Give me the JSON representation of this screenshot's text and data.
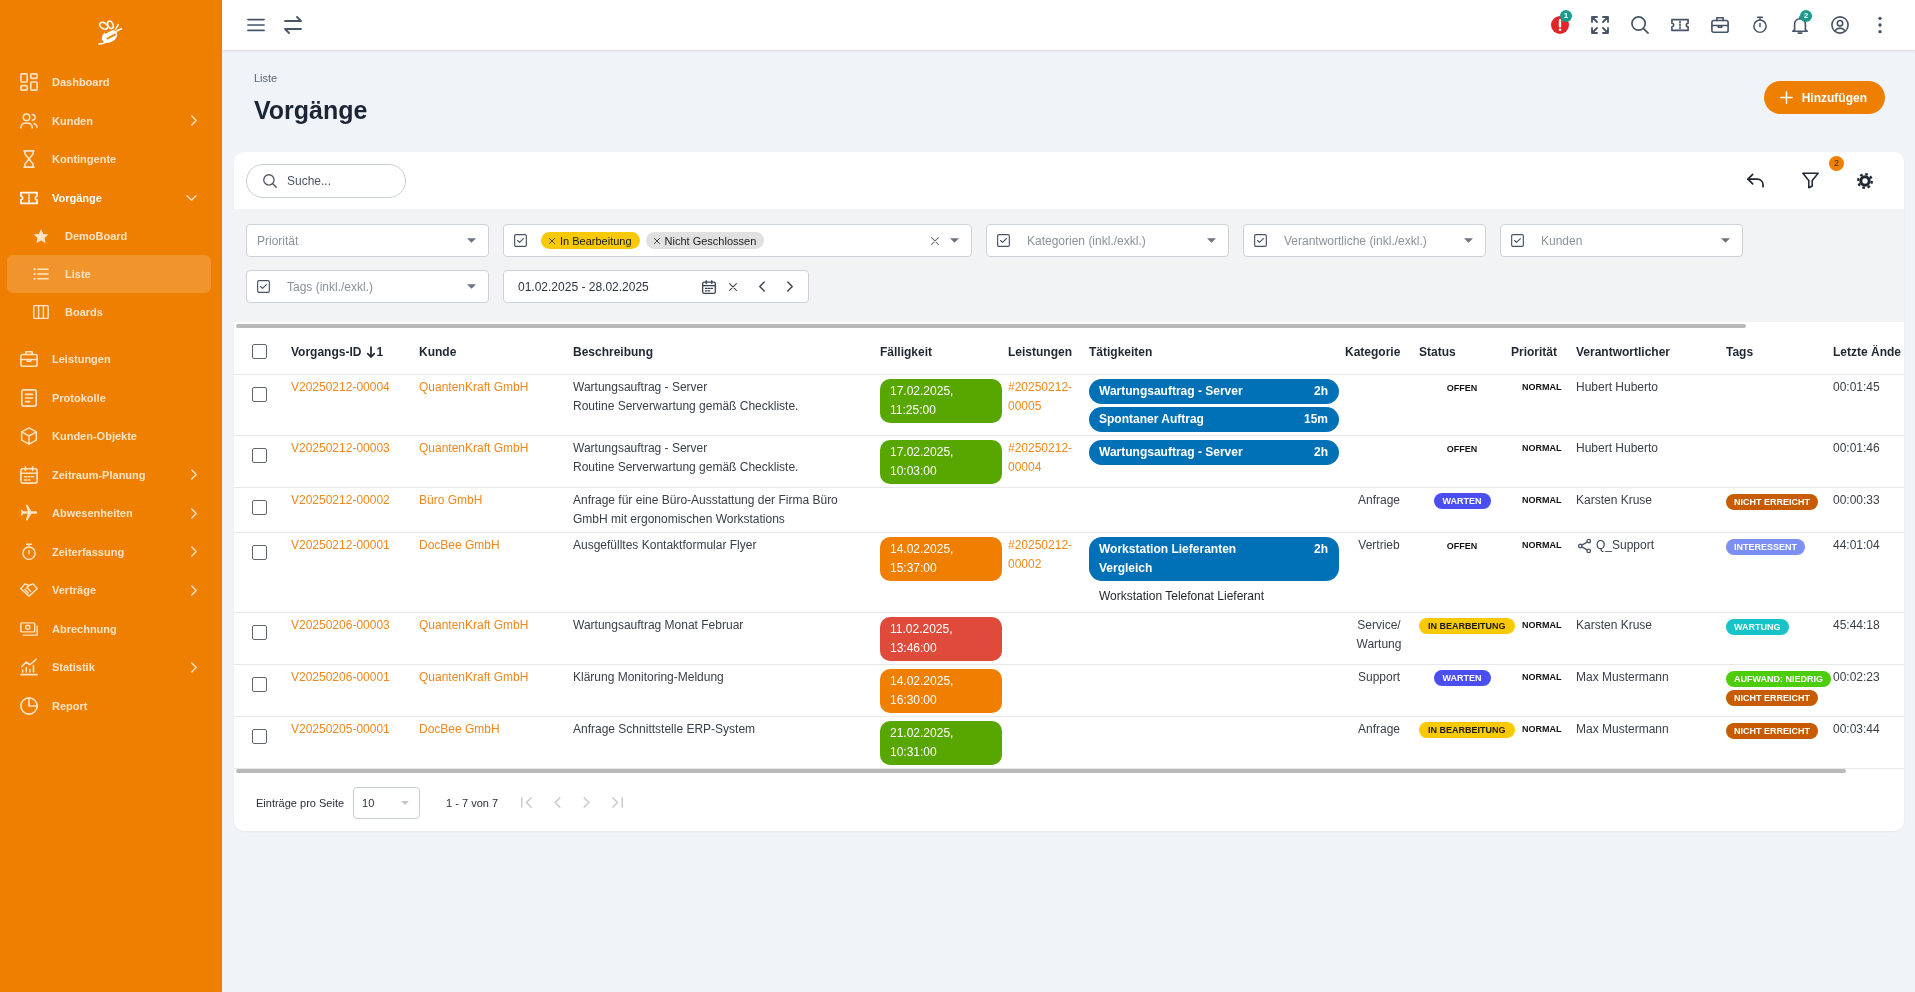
{
  "sidebar": {
    "items": [
      {
        "label": "Dashboard",
        "has_submenu": false,
        "expanded": false,
        "selected": false
      },
      {
        "label": "Kunden",
        "has_submenu": true,
        "expanded": false,
        "selected": false
      },
      {
        "label": "Kontingente",
        "has_submenu": false,
        "expanded": false,
        "selected": false
      },
      {
        "label": "Vorgänge",
        "has_submenu": true,
        "expanded": true,
        "selected": false,
        "children": [
          {
            "label": "DemoBoard",
            "selected": false
          },
          {
            "label": "Liste",
            "selected": true
          },
          {
            "label": "Boards",
            "selected": false
          }
        ]
      },
      {
        "label": "Leistungen",
        "has_submenu": false,
        "expanded": false,
        "selected": false
      },
      {
        "label": "Protokolle",
        "has_submenu": false,
        "expanded": false,
        "selected": false
      },
      {
        "label": "Kunden-Objekte",
        "has_submenu": false,
        "expanded": false,
        "selected": false
      },
      {
        "label": "Zeitraum-Planung",
        "has_submenu": true,
        "expanded": false,
        "selected": false
      },
      {
        "label": "Abwesenheiten",
        "has_submenu": true,
        "expanded": false,
        "selected": false
      },
      {
        "label": "Zeiterfassung",
        "has_submenu": true,
        "expanded": false,
        "selected": false
      },
      {
        "label": "Verträge",
        "has_submenu": true,
        "expanded": false,
        "selected": false
      },
      {
        "label": "Abrechnung",
        "has_submenu": false,
        "expanded": false,
        "selected": false
      },
      {
        "label": "Statistik",
        "has_submenu": true,
        "expanded": false,
        "selected": false
      },
      {
        "label": "Report",
        "has_submenu": false,
        "expanded": false,
        "selected": false
      }
    ]
  },
  "topbar": {
    "alert_badge": "1",
    "notification_badge": "2"
  },
  "header": {
    "breadcrumb": "Liste",
    "title": "Vorgänge",
    "add_button": "Hinzufügen"
  },
  "toolbar": {
    "search": {
      "placeholder": "Suche..."
    },
    "filter_badge": "2"
  },
  "filters": [
    {
      "kind": "select",
      "placeholder": "Priorität"
    },
    {
      "kind": "chips",
      "checked": true,
      "chips": [
        {
          "label": "In Bearbeitung",
          "color": "#f9c900"
        },
        {
          "label": "Nicht Geschlossen",
          "color": "#e1e1e1"
        }
      ]
    },
    {
      "kind": "select",
      "checked": true,
      "placeholder": "Kategorien (inkl./exkl.)"
    },
    {
      "kind": "select",
      "checked": true,
      "placeholder": "Verantwortliche (inkl./exkl.)"
    },
    {
      "kind": "select",
      "checked": true,
      "placeholder": "Kunden"
    },
    {
      "kind": "select",
      "checked": true,
      "placeholder": "Tags (inkl./exkl.)"
    },
    {
      "kind": "daterange",
      "value": "01.02.2025 - 28.02.2025"
    }
  ],
  "table": {
    "all_checked": false,
    "columns": [
      {
        "label": "Vorgangs-ID",
        "sorted": true,
        "sort_rank": "1"
      },
      {
        "label": "Kunde",
        "sorted": false
      },
      {
        "label": "Beschreibung",
        "sorted": false
      },
      {
        "label": "Fälligkeit",
        "sorted": false
      },
      {
        "label": "Leistungen",
        "sorted": false
      },
      {
        "label": "Tätigkeiten",
        "sorted": false
      },
      {
        "label": "Kategorie",
        "sorted": false
      },
      {
        "label": "Status",
        "sorted": false
      },
      {
        "label": "Priorität",
        "sorted": false
      },
      {
        "label": "Verantwortlicher",
        "sorted": false
      },
      {
        "label": "Tags",
        "sorted": false
      },
      {
        "label": "Letzte Ände",
        "sorted": false
      }
    ],
    "rows": [
      {
        "checked": false,
        "id": "V20250212-00004",
        "customer": "QuantenKraft GmbH",
        "description": [
          "Wartungsauftrag - Server",
          "Routine Serverwartung gemäß Checkliste."
        ],
        "due": {
          "text": "17.02.2025, 11:25:00",
          "color": "#58a700"
        },
        "service": "#20250212-00005",
        "activities": [
          {
            "kind": "pill",
            "label": "Wartungsauftrag - Server",
            "duration": "2h"
          },
          {
            "kind": "pill",
            "label": "Spontaner Auftrag",
            "duration": "15m"
          }
        ],
        "status": {
          "kind": "plain",
          "label": "OFFEN"
        },
        "priority": "NORMAL",
        "responsible": {
          "kind": "person",
          "name": "Hubert Huberto"
        },
        "changed": "00:01:45"
      },
      {
        "checked": false,
        "id": "V20250212-00003",
        "customer": "QuantenKraft GmbH",
        "description": [
          "Wartungsauftrag - Server",
          "Routine Serverwartung gemäß Checkliste."
        ],
        "due": {
          "text": "17.02.2025, 10:03:00",
          "color": "#58a700"
        },
        "service": "#20250212-00004",
        "activities": [
          {
            "kind": "pill",
            "label": "Wartungsauftrag - Server",
            "duration": "2h"
          }
        ],
        "status": {
          "kind": "plain",
          "label": "OFFEN"
        },
        "priority": "NORMAL",
        "responsible": {
          "kind": "person",
          "name": "Hubert Huberto"
        },
        "changed": "00:01:46"
      },
      {
        "checked": false,
        "id": "V20250212-00002",
        "customer": "Büro GmbH",
        "description": [
          "Anfrage für eine Büro-Ausstattung der Firma Büro GmbH mit ergonomischen Workstations"
        ],
        "category": "Anfrage",
        "status": {
          "kind": "pill",
          "label": "WARTEN",
          "color": "#4b4ff2"
        },
        "priority": "NORMAL",
        "responsible": {
          "kind": "person",
          "name": "Karsten Kruse"
        },
        "tags": [
          {
            "label": "NICHT ERREICHT",
            "color": "#c65b00"
          }
        ],
        "changed": "00:00:33"
      },
      {
        "checked": false,
        "id": "V20250212-00001",
        "customer": "DocBee GmbH",
        "description": [
          "Ausgefülltes Kontaktformular Flyer"
        ],
        "due": {
          "text": "14.02.2025, 15:37:00",
          "color": "#f07f00"
        },
        "service": "#20250212-00002",
        "activities": [
          {
            "kind": "pill",
            "label": "Workstation Lieferanten Vergleich",
            "duration": "2h"
          },
          {
            "kind": "plain",
            "label": "Workstation Telefonat Lieferant"
          }
        ],
        "category": "Vertrieb",
        "status": {
          "kind": "plain",
          "label": "OFFEN"
        },
        "priority": "NORMAL",
        "responsible": {
          "kind": "group",
          "name": "Q_Support"
        },
        "tags": [
          {
            "label": "INTERESSENT",
            "color": "#7b8ff5"
          }
        ],
        "changed": "44:01:04"
      },
      {
        "checked": false,
        "id": "V20250206-00003",
        "customer": "QuantenKraft GmbH",
        "description": [
          "Wartungsauftrag Monat Februar"
        ],
        "due": {
          "text": "11.02.2025, 13:46:00",
          "color": "#e04a3a"
        },
        "category": "Service/Wartung",
        "status": {
          "kind": "pill",
          "label": "IN BEARBEITUNG",
          "color": "#f9c900"
        },
        "priority": "NORMAL",
        "responsible": {
          "kind": "person",
          "name": "Karsten Kruse"
        },
        "tags": [
          {
            "label": "WARTUNG",
            "color": "#16c4c8"
          }
        ],
        "changed": "45:44:18"
      },
      {
        "checked": false,
        "id": "V20250206-00001",
        "customer": "QuantenKraft GmbH",
        "description": [
          "Klärung Monitoring-Meldung"
        ],
        "due": {
          "text": "14.02.2025, 16:30:00",
          "color": "#f07f00"
        },
        "category": "Support",
        "status": {
          "kind": "pill",
          "label": "WARTEN",
          "color": "#4b4ff2"
        },
        "priority": "NORMAL",
        "responsible": {
          "kind": "person",
          "name": "Max Mustermann"
        },
        "tags": [
          {
            "label": "AUFWAND: NIEDRIG",
            "color": "#4dcc0a"
          },
          {
            "label": "NICHT ERREICHT",
            "color": "#c65b00"
          }
        ],
        "changed": "00:02:23"
      },
      {
        "checked": false,
        "id": "V20250205-00001",
        "customer": "DocBee GmbH",
        "description": [
          "Anfrage Schnittstelle ERP-System"
        ],
        "due": {
          "text": "21.02.2025, 10:31:00",
          "color": "#58a700"
        },
        "category": "Anfrage",
        "status": {
          "kind": "pill",
          "label": "IN BEARBEITUNG",
          "color": "#f9c900"
        },
        "priority": "NORMAL",
        "responsible": {
          "kind": "person",
          "name": "Max Mustermann"
        },
        "tags": [
          {
            "label": "NICHT ERREICHT",
            "color": "#c65b00"
          }
        ],
        "changed": "00:03:44"
      }
    ]
  },
  "pager": {
    "label": "Einträge pro Seite",
    "page_size": "10",
    "range": "1 - 7 von 7",
    "nav": [
      {
        "kind": "first",
        "disabled": true
      },
      {
        "kind": "prev",
        "disabled": true
      },
      {
        "kind": "next",
        "disabled": true
      },
      {
        "kind": "last",
        "disabled": true
      }
    ]
  }
}
